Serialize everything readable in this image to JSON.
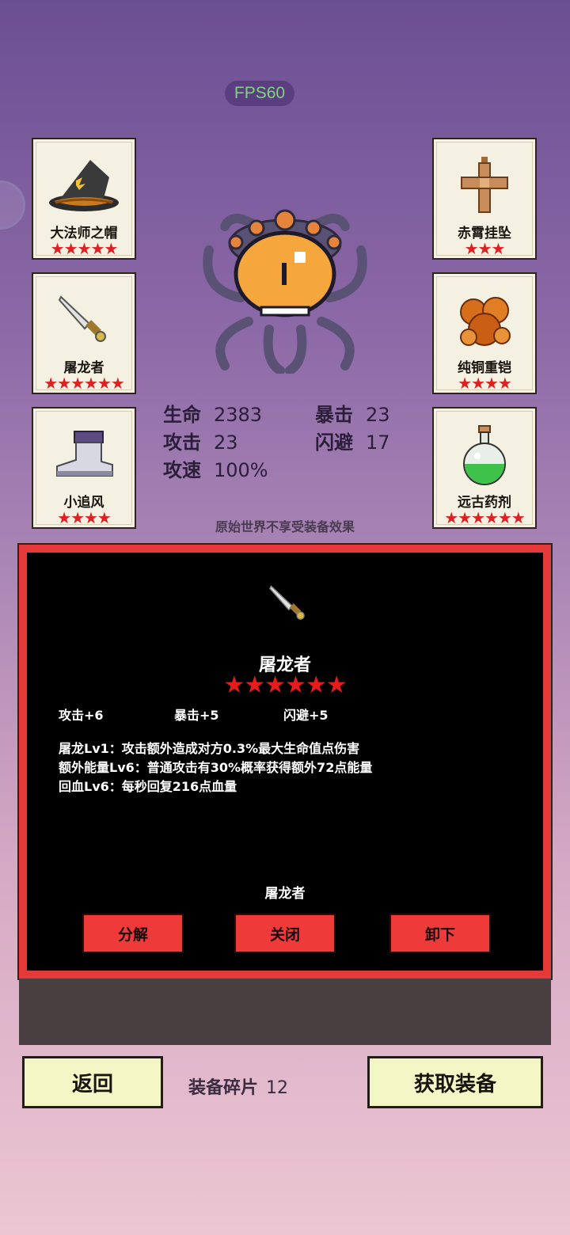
{
  "hud": {
    "fps": "FPS60"
  },
  "equipment": {
    "left": [
      {
        "name": "大法师之帽",
        "stars": "★★★★★"
      },
      {
        "name": "屠龙者",
        "stars": "★★★★★★"
      },
      {
        "name": "小追风",
        "stars": "★★★★"
      }
    ],
    "right": [
      {
        "name": "赤霄挂坠",
        "stars": "★★★"
      },
      {
        "name": "纯铜重铠",
        "stars": "★★★★"
      },
      {
        "name": "远古药剂",
        "stars": "★★★★★★"
      }
    ]
  },
  "stats": {
    "hp_label": "生命",
    "hp": "2383",
    "crit_label": "暴击",
    "crit": "23",
    "atk_label": "攻击",
    "atk": "23",
    "dodge_label": "闪避",
    "dodge": "17",
    "speed_label": "攻速",
    "speed": "100%"
  },
  "note": "原始世界不享受装备效果",
  "detail": {
    "name": "屠龙者",
    "stars": "★★★★★★",
    "attrs": [
      "攻击+6",
      "暴击+5",
      "闪避+5"
    ],
    "skills": [
      "屠龙Lv1：攻击额外造成对方0.3%最大生命值点伤害",
      "额外能量Lv6：普通攻击有30%概率获得额外72点能量",
      "回血Lv6：每秒回复216点血量"
    ],
    "footer_name": "屠龙者",
    "buttons": {
      "decompose": "分解",
      "close": "关闭",
      "unequip": "卸下"
    }
  },
  "bottom": {
    "back": "返回",
    "shards_label": "装备碎片",
    "shards_count": "12",
    "get_equipment": "获取装备"
  },
  "colors": {
    "star": "#e02020",
    "panel_border": "#e63a3a",
    "button": "#ef3a3a",
    "bottom_button": "#f3f7c6"
  }
}
